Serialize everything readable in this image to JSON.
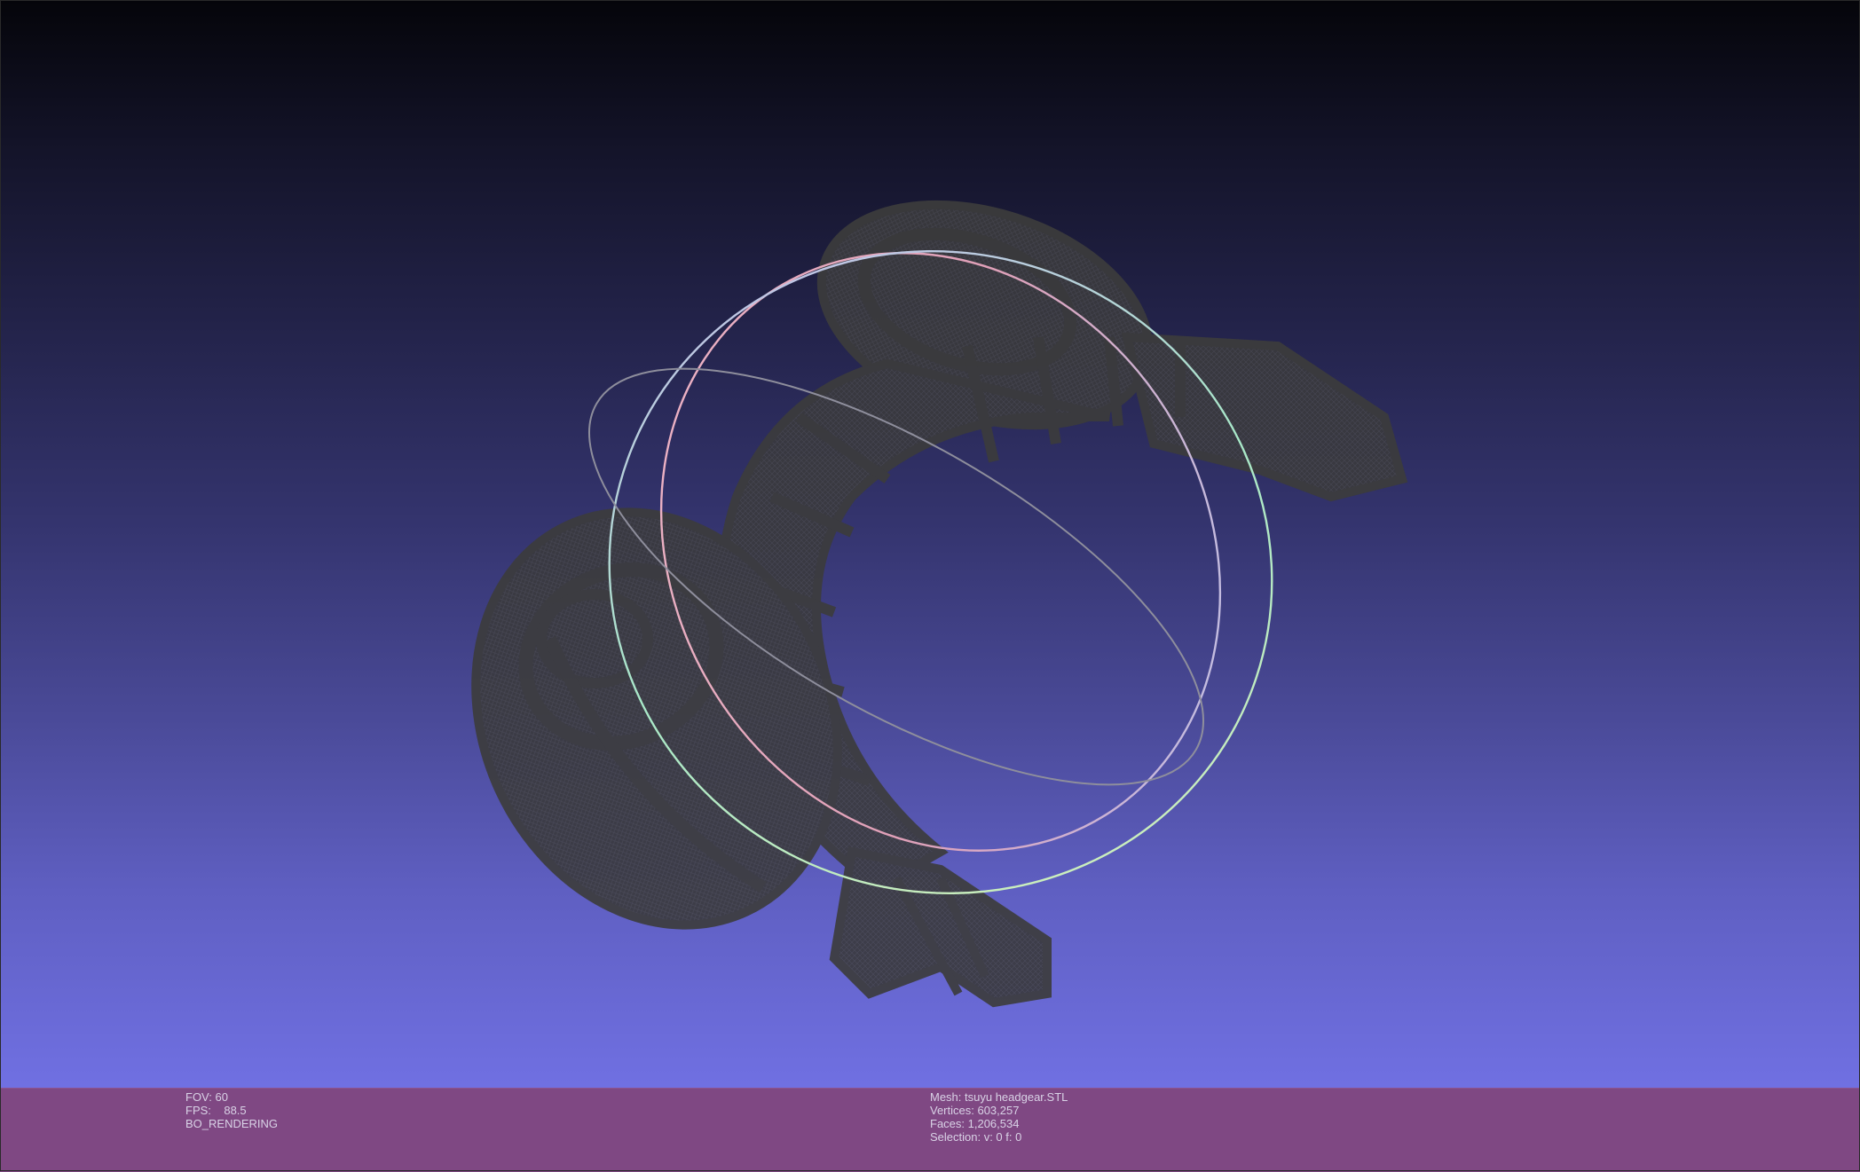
{
  "viewport": {
    "model": "mesh-wireframe",
    "colors": {
      "mesh": "#3c3c3c",
      "background_top": "#05050a",
      "background_bottom": "#7070e2",
      "trackball_ring_a": "#e8b4c8",
      "trackball_ring_b": "#b4e8c8",
      "trackball_ring_c": "#9a9aa6"
    }
  },
  "status_left": {
    "fov": "FOV: 60",
    "fps": "FPS:    88.5",
    "mode": "BO_RENDERING"
  },
  "status_right": {
    "mesh": "Mesh: tsuyu headgear.STL",
    "vertices": "Vertices: 603,257",
    "faces": "Faces: 1,206,534",
    "selection": "Selection: v: 0 f: 0"
  },
  "status_bar_color": "#7f4883"
}
